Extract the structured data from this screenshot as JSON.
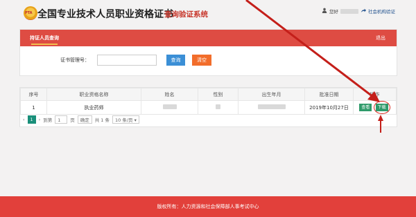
{
  "header": {
    "logo_text": "PTA",
    "title_main": "全国专业技术人员职业资格证书",
    "title_sub": "查询验证系统",
    "greeting": "您好",
    "org_link": "社会机构验证"
  },
  "panel": {
    "tab_label": "持证人员查询",
    "exit_label": "退出",
    "search_label": "证书管理号：",
    "search_value": "",
    "query_button": "查询",
    "clear_button": "清空"
  },
  "table": {
    "headers": [
      "序号",
      "职业资格名称",
      "姓名",
      "性别",
      "出生年月",
      "批准日期",
      "操作"
    ],
    "rows": [
      {
        "index": "1",
        "qualification": "执业药师",
        "name": "",
        "gender": "",
        "birth": "",
        "date": "2019年10月27日",
        "view_label": "查看",
        "download_label": "下载"
      }
    ]
  },
  "pager": {
    "current_page": "1",
    "goto_label": "到第",
    "goto_value": "1",
    "page_unit": "页",
    "confirm_label": "确定",
    "total_label": "共 1 条",
    "page_size": "10 条/页"
  },
  "footer": {
    "copyright": "版权所有：人力资源和社会保障部人事考试中心"
  },
  "colors": {
    "accent": "#de4c43",
    "query": "#3b8fd6",
    "clear": "#f26d2b",
    "action": "#2f9a6a",
    "annotation": "#d9261c"
  }
}
